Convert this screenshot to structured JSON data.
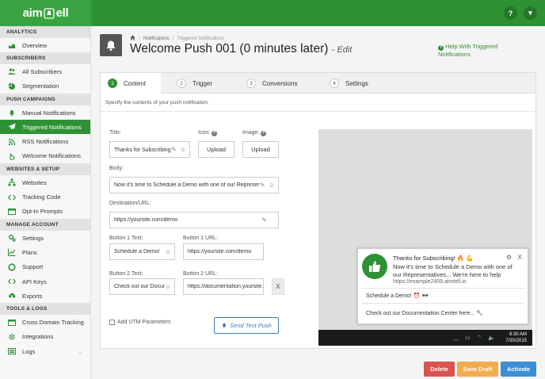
{
  "app": {
    "logo_text_left": "aim",
    "logo_text_right": "ell"
  },
  "topbar": {
    "help_icon": "?",
    "menu_icon": "▾"
  },
  "sidebar": {
    "sections": [
      {
        "title": "ANALYTICS",
        "items": [
          {
            "label": "Overview",
            "icon": "chart-icon"
          }
        ]
      },
      {
        "title": "SUBSCRIBERS",
        "items": [
          {
            "label": "All Subscribers",
            "icon": "users-icon"
          },
          {
            "label": "Segmentation",
            "icon": "pie-icon"
          }
        ]
      },
      {
        "title": "PUSH CAMPAIGNS",
        "items": [
          {
            "label": "Manual Notifications",
            "icon": "bell-icon"
          },
          {
            "label": "Triggered Notifications",
            "icon": "paper-plane-icon"
          },
          {
            "label": "RSS Notifications",
            "icon": "rss-icon"
          },
          {
            "label": "Welcome Notifications",
            "icon": "hand-icon"
          }
        ]
      },
      {
        "title": "WEBSITES & SETUP",
        "items": [
          {
            "label": "Websites",
            "icon": "sitemap-icon"
          },
          {
            "label": "Tracking Code",
            "icon": "code-icon"
          },
          {
            "label": "Opt-In Prompts",
            "icon": "window-icon"
          }
        ]
      },
      {
        "title": "MANAGE ACCOUNT",
        "items": [
          {
            "label": "Settings",
            "icon": "cogs-icon"
          },
          {
            "label": "Plans",
            "icon": "line-chart-icon"
          },
          {
            "label": "Support",
            "icon": "life-ring-icon"
          },
          {
            "label": "API Keys",
            "icon": "code-icon"
          },
          {
            "label": "Exports",
            "icon": "cloud-download-icon"
          }
        ]
      },
      {
        "title": "TOOLS & LOGS",
        "items": [
          {
            "label": "Cross Domain Tracking",
            "icon": "window-icon"
          },
          {
            "label": "Integrations",
            "icon": "gear-icon"
          },
          {
            "label": "Logs",
            "icon": "list-icon"
          }
        ]
      }
    ]
  },
  "header": {
    "breadcrumb": [
      "Notifications",
      "Triggered Notifications"
    ],
    "title": "Welcome Push 001 (0 minutes later)",
    "title_suffix": "- Edit",
    "help": "Help With Triggered Notifications"
  },
  "tabs": [
    {
      "num": "1",
      "label": "Content"
    },
    {
      "num": "2",
      "label": "Trigger"
    },
    {
      "num": "3",
      "label": "Conversions"
    },
    {
      "num": "4",
      "label": "Settings"
    }
  ],
  "form": {
    "description": "Specify the contents of your push notification.",
    "title_label": "Title:",
    "title_value": "Thanks for Subscribing! 🔥 💪",
    "icon_label": "Icon:",
    "image_label": "Image:",
    "upload_label": "Upload",
    "body_label": "Body:",
    "body_value": "Now it's time to Schedule a Demo with one of our Representatives",
    "url_label": "Destination/URL:",
    "url_value": "https://yoursite.com/demo",
    "b1_text_label": "Button 1 Text:",
    "b1_text_value": "Schedule a Demo!",
    "b1_url_label": "Button 1 URL:",
    "b1_url_value": "https://yoursite.com/demo",
    "b2_text_label": "Button 2 Text:",
    "b2_text_value": "Check out our Documentation",
    "b2_url_label": "Button 2 URL:",
    "b2_url_value": "https://documentation.yoursite.com",
    "remove_label": "X",
    "utm_label": "Add UTM Parameters",
    "test_label": "Send Test Push"
  },
  "preview": {
    "title": "Thanks for Subscribing! 🔥 💪",
    "body": "Now it's time to Schedule a Demo with one of our Representatives... We're here to help",
    "url": "https://example2459.aimtell.io",
    "button1": "Schedule a Demo! ⏰ 🕶",
    "button2": "Check out our Documentation Center here... 🔧",
    "close": "X",
    "time": "6:30 AM",
    "date": "7/30/2015"
  },
  "actions": {
    "delete": "Delete",
    "save_draft": "Save Draft",
    "activate": "Activate"
  },
  "colors": {
    "brand": "#2e9234",
    "delete": "#d9534f",
    "draft": "#f0ad4e",
    "activate": "#3b8fd5"
  }
}
